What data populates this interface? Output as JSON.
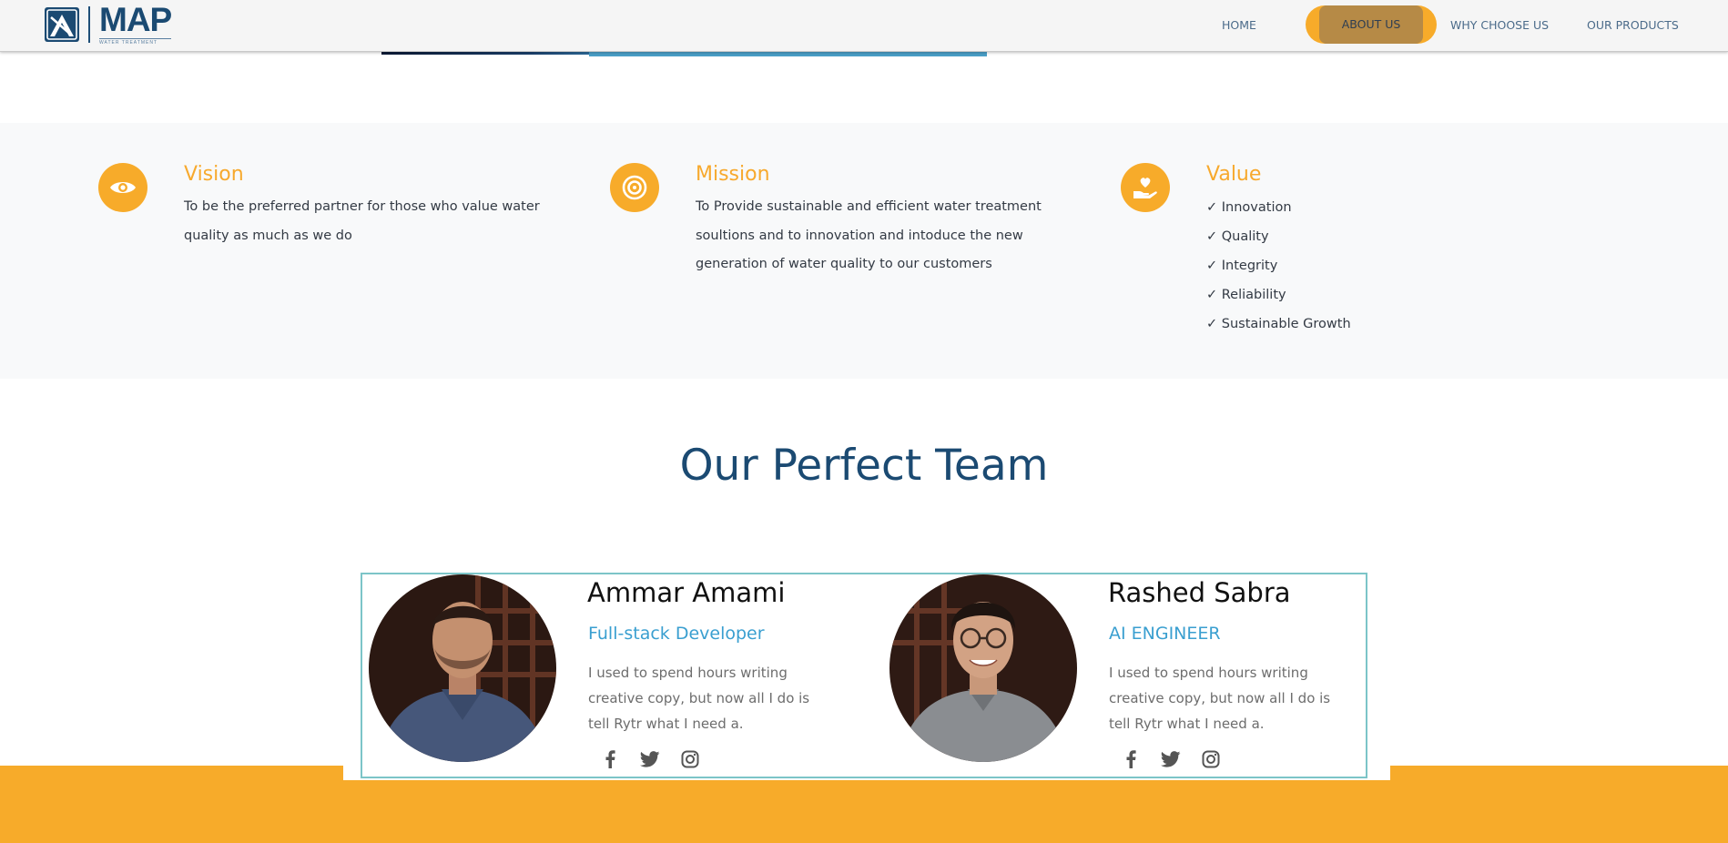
{
  "brand": {
    "name": "MAP",
    "tagline": "WATER TREATMENT",
    "colors": {
      "primary": "#1b4a72",
      "accent": "#f7ab2a",
      "teal": "#7cc5c8",
      "link": "#3a9fd0"
    }
  },
  "nav": {
    "items": [
      {
        "label": "HOME"
      },
      {
        "label": "ABOUT US",
        "active": true
      },
      {
        "label": "WHY CHOOSE US"
      },
      {
        "label": "OUR PRODUCTS"
      }
    ]
  },
  "vmv": {
    "vision": {
      "icon": "eye-icon",
      "title": "Vision",
      "text": "To be the preferred partner for those who value water quality as much as we do"
    },
    "mission": {
      "icon": "target-icon",
      "title": "Mission",
      "text": "To Provide sustainable and efficient water treatment soultions and to innovation and intoduce the new generation of water quality to our customers"
    },
    "value": {
      "icon": "hand-heart-icon",
      "title": "Value",
      "items": [
        "✓ Innovation",
        "✓ Quality",
        "✓ Integrity",
        "✓ Reliability",
        "✓ Sustainable Growth"
      ]
    }
  },
  "team": {
    "title": "Our Perfect Team",
    "members": [
      {
        "name": "Ammar Amami",
        "role": "Full-stack Developer",
        "bio": "I used to spend hours writing creative copy, but now all I do is tell Rytr what I need a.",
        "social": [
          "facebook-icon",
          "twitter-icon",
          "instagram-icon"
        ]
      },
      {
        "name": "Rashed Sabra",
        "role": "AI ENGINEER",
        "bio": "I used to spend hours writing creative copy, but now all I do is tell Rytr what I need a.",
        "social": [
          "facebook-icon",
          "twitter-icon",
          "instagram-icon"
        ]
      }
    ]
  }
}
